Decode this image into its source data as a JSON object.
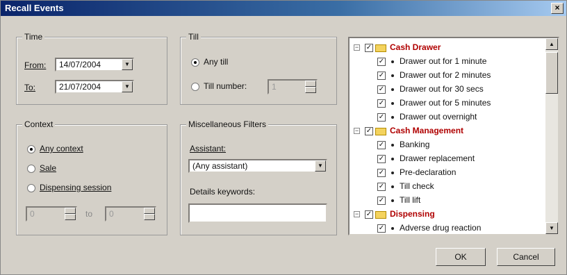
{
  "window": {
    "title": "Recall Events"
  },
  "time": {
    "group_label": "Time",
    "from_label": "From:",
    "from_value": "14/07/2004",
    "to_label": "To:",
    "to_value": "21/07/2004"
  },
  "till": {
    "group_label": "Till",
    "any_till_label": "Any till",
    "till_number_label": "Till number:",
    "till_number_value": "1"
  },
  "context": {
    "group_label": "Context",
    "any_context_label": "Any context",
    "sale_label": "Sale",
    "dispensing_session_label": "Dispensing session",
    "spin_from_value": "0",
    "to_label": "to",
    "spin_to_value": "0"
  },
  "misc": {
    "group_label": "Miscellaneous Filters",
    "assistant_label": "Assistant:",
    "assistant_value": "(Any assistant)",
    "details_label": "Details keywords:",
    "details_value": ""
  },
  "tree": {
    "categories": [
      {
        "label": "Cash Drawer",
        "items": [
          "Drawer out for 1 minute",
          "Drawer out for 2 minutes",
          "Drawer out for 30 secs",
          "Drawer out for 5 minutes",
          "Drawer out overnight"
        ]
      },
      {
        "label": "Cash Management",
        "items": [
          "Banking",
          "Drawer replacement",
          "Pre-declaration",
          "Till check",
          "Till lift"
        ]
      },
      {
        "label": "Dispensing",
        "items": [
          "Adverse drug reaction"
        ]
      }
    ]
  },
  "buttons": {
    "ok": "OK",
    "cancel": "Cancel"
  }
}
